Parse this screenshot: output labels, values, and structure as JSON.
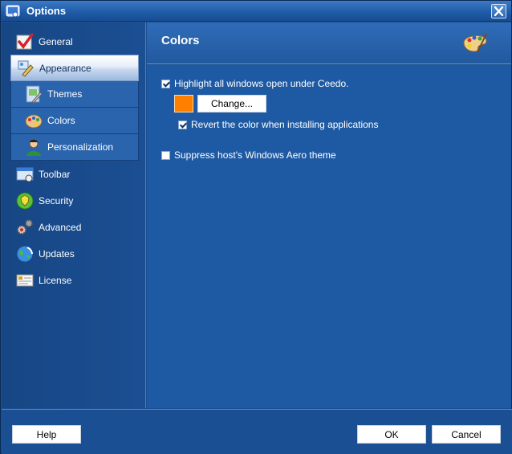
{
  "window": {
    "title": "Options"
  },
  "sidebar": {
    "items": [
      {
        "label": "General",
        "icon": "general-checkmark-icon"
      },
      {
        "label": "Appearance",
        "icon": "appearance-icon",
        "selected": true
      },
      {
        "label": "Themes",
        "icon": "themes-icon",
        "sub": true
      },
      {
        "label": "Colors",
        "icon": "palette-icon",
        "sub": true
      },
      {
        "label": "Personalization",
        "icon": "person-icon",
        "sub": true
      },
      {
        "label": "Toolbar",
        "icon": "toolbar-icon"
      },
      {
        "label": "Security",
        "icon": "security-icon"
      },
      {
        "label": "Advanced",
        "icon": "gears-icon"
      },
      {
        "label": "Updates",
        "icon": "globe-update-icon"
      },
      {
        "label": "License",
        "icon": "license-certificate-icon"
      }
    ]
  },
  "content": {
    "title": "Colors",
    "highlight_label": "Highlight all windows open under Ceedo.",
    "highlight_checked": true,
    "highlight_color": "#ff7f00",
    "change_label": "Change...",
    "revert_label": "Revert the color when installing applications",
    "revert_checked": true,
    "suppress_label": "Suppress host's Windows Aero theme",
    "suppress_checked": false
  },
  "footer": {
    "help_label": "Help",
    "ok_label": "OK",
    "cancel_label": "Cancel"
  }
}
